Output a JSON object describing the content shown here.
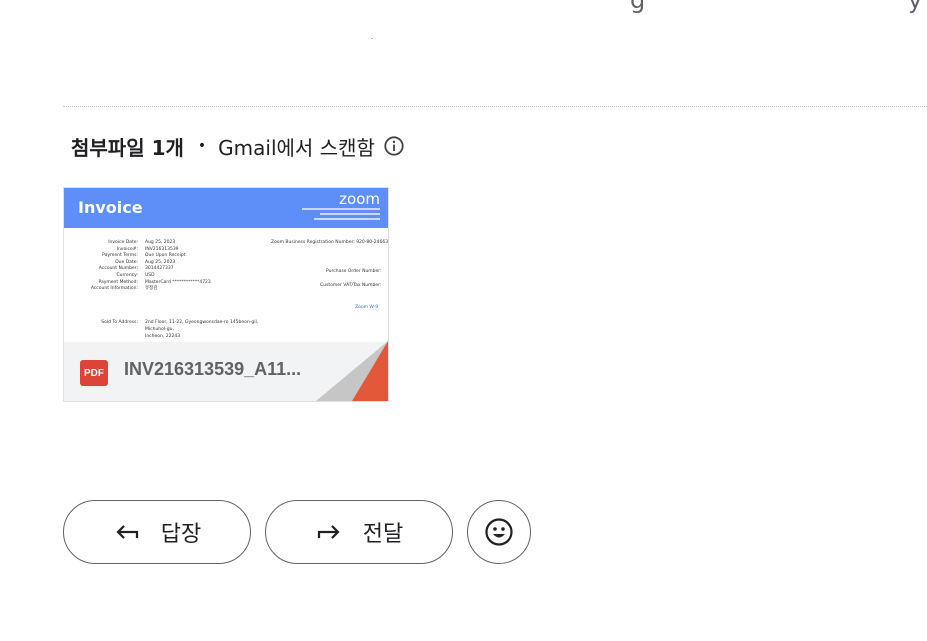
{
  "top": {
    "fragment": "g",
    "fragment2": "y"
  },
  "attachments": {
    "count_label": "첨부파일 1개",
    "bullet": "•",
    "scan_label": "Gmail에서 스캔함",
    "file": {
      "type_badge": "PDF",
      "name": "INV216313539_A11...",
      "preview": {
        "title": "Invoice",
        "brand": "zoom",
        "fields": [
          {
            "label": "Invoice Date:",
            "value": "Aug 25, 2023"
          },
          {
            "label": "Invoice#:",
            "value": "INV216313539"
          },
          {
            "label": "Payment Terms:",
            "value": "Due Upon Receipt"
          },
          {
            "label": "Due Date:",
            "value": "Aug 25, 2023"
          },
          {
            "label": "Account Number:",
            "value": "3014427337"
          },
          {
            "label": "Currency:",
            "value": "USD"
          },
          {
            "label": "Payment Method:",
            "value": "MasterCard ************4723"
          },
          {
            "label": "Account Information:",
            "value": "유정김"
          }
        ],
        "right_fields": [
          "Zoom Business Registration Number: 920-80-24663",
          "Purchase Order Number:",
          "Customer VAT/Tax Number:"
        ],
        "link": "Zoom W-9",
        "sold_to_label": "Sold To Address:",
        "sold_to_lines": [
          "2nd Floor, 11-22, Gyeongwonsdae-ro 145beon-gil,",
          "Michuhol-gu,",
          "Incheon, 22243"
        ]
      }
    }
  },
  "actions": {
    "reply": "답장",
    "forward": "전달"
  },
  "colors": {
    "invoice_band": "#5e8ef7",
    "pdf_red": "#db4437",
    "border": "#5f6368"
  }
}
